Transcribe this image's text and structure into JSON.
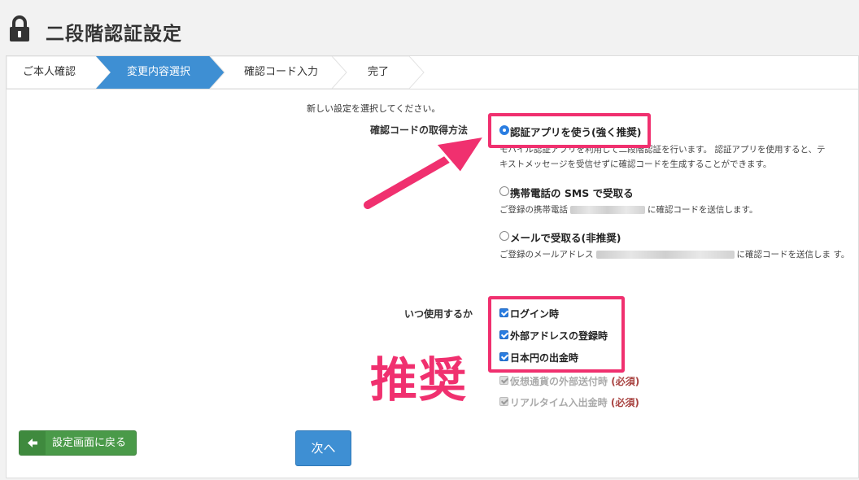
{
  "header": {
    "title": "二段階認証設定",
    "icon": "lock-icon"
  },
  "steps": [
    {
      "label": "ご本人確認",
      "active": false
    },
    {
      "label": "変更内容選択",
      "active": true
    },
    {
      "label": "確認コード入力",
      "active": false
    },
    {
      "label": "完了",
      "active": false
    }
  ],
  "form": {
    "instruction": "新しい設定を選択してください。",
    "method_label": "確認コードの取得方法",
    "options": [
      {
        "label": "認証アプリを使う(強く推奨)",
        "checked": true,
        "desc_line1": "モバイル認証アプリを利用して二段階認証を行います。 認証アプリを使用すると、テ",
        "desc_line2": "キストメッセージを受信せずに確認コードを生成することができます。"
      },
      {
        "label": "携帯電話の SMS で受取る",
        "checked": false,
        "desc_pre": "ご登録の携帯電話",
        "desc_post": "に確認コードを送信します。"
      },
      {
        "label": "メールで受取る(非推奨)",
        "checked": false,
        "desc_pre": "ご登録のメールアドレス",
        "desc_post": "に確認コードを送信しま す。"
      }
    ],
    "when_label": "いつ使用するか",
    "checkboxes": [
      {
        "label": "ログイン時",
        "checked": true,
        "disabled": false
      },
      {
        "label": "外部アドレスの登録時",
        "checked": true,
        "disabled": false
      },
      {
        "label": "日本円の出金時",
        "checked": true,
        "disabled": false
      },
      {
        "label": "仮想通貨の外部送付時",
        "required": "(必須)",
        "checked": true,
        "disabled": true
      },
      {
        "label": "リアルタイム入出金時",
        "required": "(必須)",
        "checked": true,
        "disabled": true
      }
    ]
  },
  "annotation": {
    "recommend_text": "推奨",
    "color": "#f0306f"
  },
  "buttons": {
    "back": "設定画面に戻る",
    "next": "次へ"
  },
  "colors": {
    "accent": "#3e8fd3",
    "active_step": "#3e8fd3",
    "back_button": "#4a9a49",
    "highlight": "#f0306f"
  }
}
